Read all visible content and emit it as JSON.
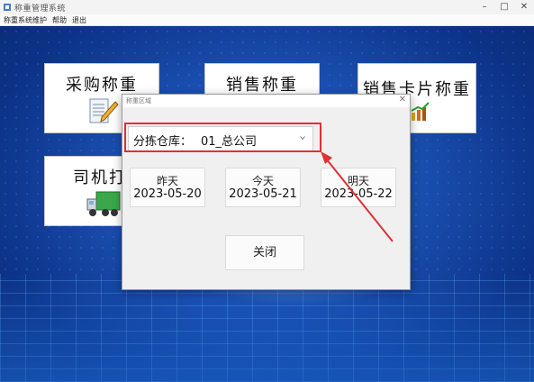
{
  "window": {
    "title": "称重管理系统"
  },
  "menu": {
    "items": [
      "称重系统维护",
      "帮助",
      "退出"
    ]
  },
  "tiles": [
    {
      "label": "采购称重",
      "icon": "document-pen-icon"
    },
    {
      "label": "销售称重",
      "icon": "scale-icon"
    },
    {
      "label": "销售卡片称重",
      "icon": "chart-growth-icon"
    },
    {
      "label": "司机打卡",
      "icon": "green-truck-icon"
    }
  ],
  "dialog": {
    "title": "称重区域",
    "warehouse_label": "分拣仓库：",
    "warehouse_value": "01_总公司",
    "dates": [
      {
        "day": "昨天",
        "date": "2023-05-20"
      },
      {
        "day": "今天",
        "date": "2023-05-21"
      },
      {
        "day": "明天",
        "date": "2023-05-22"
      }
    ],
    "close_label": "关闭"
  },
  "colors": {
    "highlight": "#e23030",
    "background": "#1a4fb0"
  }
}
